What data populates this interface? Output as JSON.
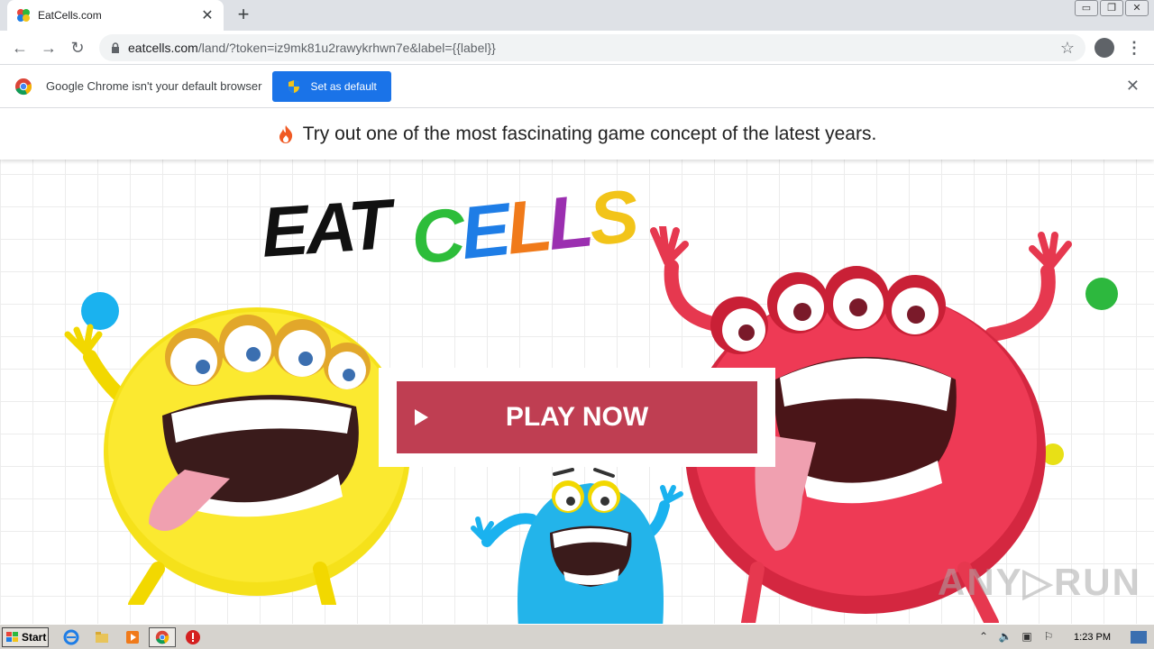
{
  "browser": {
    "tab_title": "EatCells.com",
    "tab_close": "✕",
    "new_tab": "+",
    "url_domain": "eatcells.com",
    "url_path": "/land/?token=iz9mk81u2rawykrhwn7e&label={{label}}",
    "window_controls": [
      "▭",
      "❐",
      "✕"
    ],
    "icons": [
      "back-arrow-icon",
      "forward-arrow-icon",
      "reload-icon",
      "lock-icon",
      "star-icon",
      "profile-icon",
      "menu-icon"
    ]
  },
  "infobar": {
    "message": "Google Chrome isn't your default browser",
    "button_label": "Set as default",
    "close": "✕"
  },
  "page": {
    "banner_text": "Try out one of the most fascinating game concept of the latest years.",
    "logo": {
      "word1": "EAT",
      "word2_letters": [
        {
          "ch": "C",
          "color": "#2dbd3a"
        },
        {
          "ch": "E",
          "color": "#1e7de6"
        },
        {
          "ch": "L",
          "color": "#f07a1a"
        },
        {
          "ch": "L",
          "color": "#9b2fb0"
        },
        {
          "ch": "S",
          "color": "#f2c419"
        }
      ]
    },
    "play_button": "PLAY NOW",
    "watermark": "ANY▷RUN",
    "colors": {
      "play_button": "#bf3e52",
      "dot_blue": "#1ab2ef",
      "dot_green": "#2db83e",
      "dot_yellow": "#e8e016"
    }
  },
  "taskbar": {
    "start_label": "Start",
    "clock": "1:23 PM"
  }
}
